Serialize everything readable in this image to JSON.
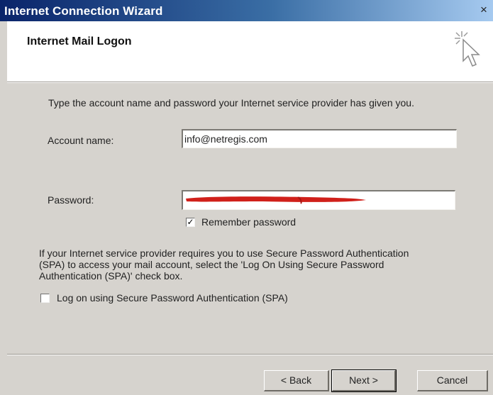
{
  "window": {
    "title": "Internet Connection Wizard",
    "close_glyph": "×"
  },
  "header": {
    "title": "Internet Mail Logon",
    "icon": "wizard-cursor-icon"
  },
  "instructions": "Type the account name and password your Internet service provider has given you.",
  "account": {
    "label": "Account name:",
    "value": "info@netregis.com"
  },
  "password": {
    "label": "Password:",
    "value": "",
    "redaction_color": "#d0201a"
  },
  "remember_password": {
    "label": "Remember password",
    "checked": true,
    "mark": "✓"
  },
  "spa": {
    "info_line1": "If your Internet service provider requires you to use Secure Password Authentication",
    "info_line2": "(SPA) to access your mail account, select the 'Log On Using Secure Password",
    "info_line3": "Authentication (SPA)' check box.",
    "label": "Log on using Secure Password Authentication (SPA)",
    "checked": false
  },
  "buttons": {
    "back": "< Back",
    "next": "Next >",
    "cancel": "Cancel"
  }
}
